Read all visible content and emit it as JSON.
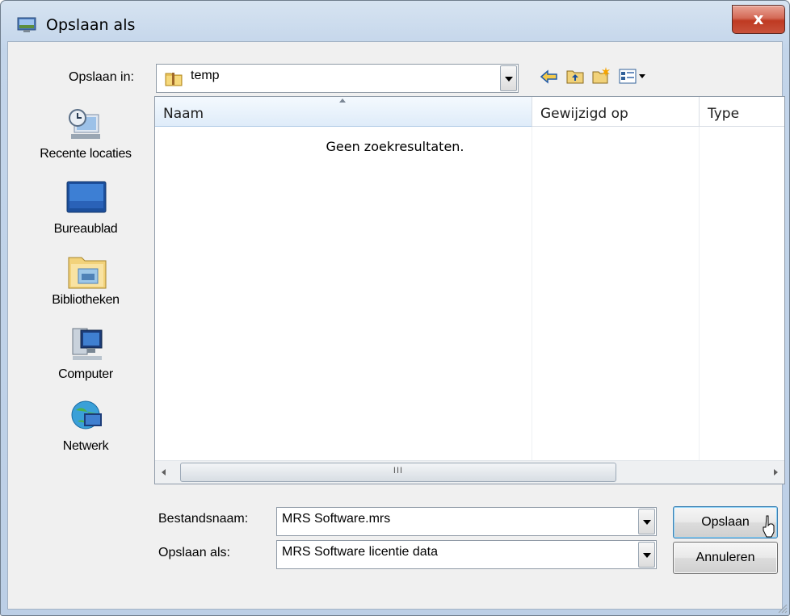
{
  "window": {
    "title": "Opslaan als",
    "close_label": "x"
  },
  "toolbar": {
    "save_in_label": "Opslaan in:",
    "save_in_value": "temp",
    "icons": [
      "back-icon",
      "up-folder-icon",
      "new-folder-icon",
      "views-menu-icon"
    ]
  },
  "places": [
    {
      "label": "Recente locaties",
      "icon": "recent-places-icon"
    },
    {
      "label": "Bureaublad",
      "icon": "desktop-icon"
    },
    {
      "label": "Bibliotheken",
      "icon": "libraries-icon"
    },
    {
      "label": "Computer",
      "icon": "computer-icon"
    },
    {
      "label": "Netwerk",
      "icon": "network-icon"
    }
  ],
  "file_list": {
    "columns": [
      "Naam",
      "Gewijzigd op",
      "Type"
    ],
    "empty_text": "Geen zoekresultaten.",
    "scroll_grip": "III"
  },
  "form": {
    "filename_label": "Bestandsnaam:",
    "filename_value": "MRS Software.mrs",
    "filetype_label": "Opslaan als:",
    "filetype_value": "MRS Software licentie data"
  },
  "buttons": {
    "save": "Opslaan",
    "cancel": "Annuleren"
  }
}
